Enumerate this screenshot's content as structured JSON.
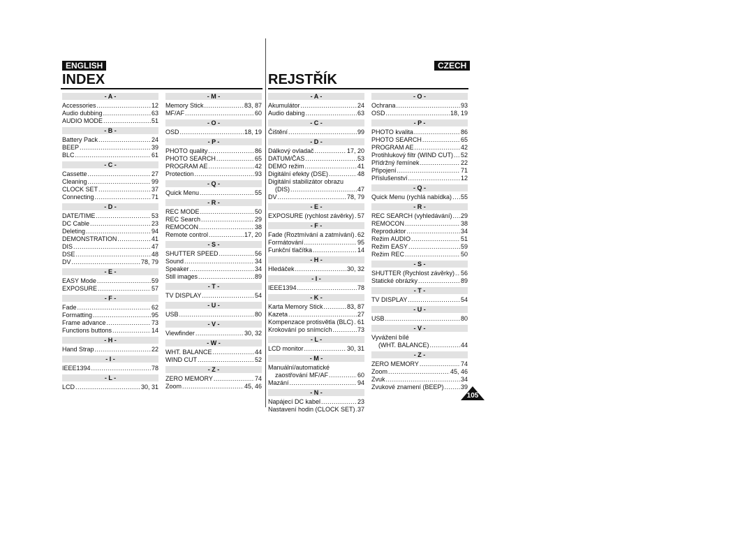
{
  "english": {
    "lang_label": "ENGLISH",
    "title": "INDEX"
  },
  "czech": {
    "lang_label": "CZECH",
    "title": "REJSTŘÍK"
  },
  "page_number": "105",
  "columns": [
    [
      {
        "h": "- A -",
        "items": [
          [
            "Accessories",
            "12"
          ],
          [
            "Audio dubbing",
            "63"
          ],
          [
            "AUDIO MODE",
            "51"
          ]
        ]
      },
      {
        "h": "- B -",
        "items": [
          [
            "Battery Pack",
            "24"
          ],
          [
            "BEEP",
            "39"
          ],
          [
            "BLC",
            "61"
          ]
        ]
      },
      {
        "h": "- C -",
        "items": [
          [
            "Cassette",
            "27"
          ],
          [
            "Cleaning",
            "99"
          ],
          [
            "CLOCK SET",
            "37"
          ],
          [
            "Connecting",
            "71"
          ]
        ]
      },
      {
        "h": "- D -",
        "items": [
          [
            "DATE/TIME",
            "53"
          ],
          [
            "DC Cable",
            "23"
          ],
          [
            "Deleting",
            "94"
          ],
          [
            "DEMONSTRATION",
            "41"
          ],
          [
            "DIS",
            "47"
          ],
          [
            "DSE",
            "48"
          ],
          [
            "DV",
            "78, 79"
          ]
        ]
      },
      {
        "h": "- E -",
        "items": [
          [
            "EASY Mode",
            "59"
          ],
          [
            "EXPOSURE",
            "57"
          ]
        ]
      },
      {
        "h": "- F -",
        "items": [
          [
            "Fade",
            "62"
          ],
          [
            "Formatting",
            "95"
          ],
          [
            "Frame advance",
            "73"
          ],
          [
            "Functions buttons",
            "14"
          ]
        ]
      },
      {
        "h": "- H -",
        "items": [
          [
            "Hand Strap",
            "22"
          ]
        ]
      },
      {
        "h": "- I -",
        "items": [
          [
            "IEEE1394",
            "78"
          ]
        ]
      },
      {
        "h": "- L -",
        "items": [
          [
            "LCD",
            "30, 31"
          ]
        ]
      }
    ],
    [
      {
        "h": "- M -",
        "items": [
          [
            "Memory Stick",
            "83, 87"
          ],
          [
            "MF/AF",
            "60"
          ]
        ]
      },
      {
        "h": "- O -",
        "items": [
          [
            "OSD",
            "18, 19"
          ]
        ]
      },
      {
        "h": "- P -",
        "items": [
          [
            "PHOTO quality",
            "86"
          ],
          [
            "PHOTO SEARCH",
            "65"
          ],
          [
            "PROGRAM AE",
            "42"
          ],
          [
            "Protection",
            "93"
          ]
        ]
      },
      {
        "h": "- Q -",
        "items": [
          [
            "Quick Menu",
            "55"
          ]
        ]
      },
      {
        "h": "- R -",
        "items": [
          [
            "REC MODE",
            "50"
          ],
          [
            "REC Search",
            "29"
          ],
          [
            "REMOCON",
            "38"
          ],
          [
            "Remote control",
            "17, 20"
          ]
        ]
      },
      {
        "h": "- S -",
        "items": [
          [
            "SHUTTER SPEED",
            "56"
          ],
          [
            "Sound",
            "34"
          ],
          [
            "Speaker",
            "34"
          ],
          [
            "Still images",
            "89"
          ]
        ]
      },
      {
        "h": "- T -",
        "items": [
          [
            "TV DISPLAY",
            "54"
          ]
        ]
      },
      {
        "h": "- U -",
        "items": [
          [
            "USB",
            "80"
          ]
        ]
      },
      {
        "h": "- V -",
        "items": [
          [
            "Viewfinder",
            "30, 32"
          ]
        ]
      },
      {
        "h": "- W -",
        "items": [
          [
            "WHT. BALANCE",
            "44"
          ],
          [
            "WIND CUT",
            "52"
          ]
        ]
      },
      {
        "h": "- Z -",
        "items": [
          [
            "ZERO MEMORY",
            "74"
          ],
          [
            "Zoom",
            "45, 46"
          ]
        ]
      }
    ],
    [
      {
        "h": "- A -",
        "items": [
          [
            "Akumulátor",
            "24"
          ],
          [
            "Audio dabing",
            "63"
          ]
        ]
      },
      {
        "h": "- C -",
        "items": [
          [
            "Čištění",
            "99"
          ]
        ]
      },
      {
        "h": "- D -",
        "items": [
          [
            "Dálkový ovladač",
            "17, 20"
          ],
          [
            "DATUM/ČAS",
            "53"
          ],
          [
            "DEMO režim",
            "41"
          ],
          [
            "Digitální efekty (DSE)",
            "48"
          ],
          [
            "Digitální stabilizátor obrazu",
            ""
          ],
          [
            "(DIS)",
            "47",
            "indent"
          ],
          [
            "DV",
            "78, 79"
          ]
        ]
      },
      {
        "h": "- E -",
        "items": [
          [
            "EXPOSURE (rychlost závěrky)",
            "57"
          ]
        ]
      },
      {
        "h": "- F -",
        "items": [
          [
            "Fade (Roztmívání a zatmívání)",
            "62"
          ],
          [
            "Formátování",
            "95"
          ],
          [
            "Funkční tlačítka",
            "14"
          ]
        ]
      },
      {
        "h": "- H -",
        "items": [
          [
            "Hledáček",
            "30, 32"
          ]
        ]
      },
      {
        "h": "- I -",
        "items": [
          [
            "IEEE1394",
            "78"
          ]
        ]
      },
      {
        "h": "- K -",
        "items": [
          [
            "Karta Memory Stick",
            "83, 87"
          ],
          [
            "Kazeta",
            "27"
          ],
          [
            "Kompenzace protisvětla (BLC)",
            "61"
          ],
          [
            "Krokování po snímcích",
            "73"
          ]
        ]
      },
      {
        "h": "- L -",
        "items": [
          [
            "LCD monitor",
            "30, 31"
          ]
        ]
      },
      {
        "h": "- M -",
        "items": [
          [
            "Manuální/automatické",
            ""
          ],
          [
            "zaostřování MF/AF",
            "60",
            "indent"
          ],
          [
            "Mazání",
            "94"
          ]
        ]
      },
      {
        "h": "- N -",
        "items": [
          [
            "Napájecí DC kabel",
            "23"
          ],
          [
            "Nastavení hodin (CLOCK SET)",
            "37"
          ]
        ]
      }
    ],
    [
      {
        "h": "- O -",
        "items": [
          [
            "Ochrana",
            "93"
          ],
          [
            "OSD",
            "18, 19"
          ]
        ]
      },
      {
        "h": "- P -",
        "items": [
          [
            "PHOTO kvalita",
            "86"
          ],
          [
            "PHOTO SEARCH",
            "65"
          ],
          [
            "PROGRAM AE",
            "42"
          ],
          [
            "Protihlukový filtr (WIND CUT)",
            "52"
          ],
          [
            "Přídržný řemínek",
            "22"
          ],
          [
            "Připojení",
            "71"
          ],
          [
            "Příslušenství",
            "12"
          ]
        ]
      },
      {
        "h": "- Q -",
        "items": [
          [
            "Quick Menu (rychlá nabídka)",
            "55"
          ]
        ]
      },
      {
        "h": "- R -",
        "items": [
          [
            "REC SEARCH (vyhledávání)",
            "29"
          ],
          [
            "REMOCON",
            "38"
          ],
          [
            "Reproduktor",
            "34"
          ],
          [
            "Režim AUDIO",
            "51"
          ],
          [
            "Režim EASY",
            "59"
          ],
          [
            "Režim REC",
            "50"
          ]
        ]
      },
      {
        "h": "- S -",
        "items": [
          [
            "SHUTTER (Rychlost závěrky)",
            "56"
          ],
          [
            "Statické obrázky",
            "89"
          ]
        ]
      },
      {
        "h": "- T -",
        "items": [
          [
            "TV DISPLAY",
            "54"
          ]
        ]
      },
      {
        "h": "- U -",
        "items": [
          [
            "USB",
            "80"
          ]
        ]
      },
      {
        "h": "- V -",
        "items": [
          [
            "Vyvážení bílé",
            ""
          ],
          [
            "(WHT. BALANCE)",
            "44",
            "indent"
          ]
        ]
      },
      {
        "h": "- Z -",
        "items": [
          [
            "ZERO MEMORY",
            "74"
          ],
          [
            "Zoom",
            "45, 46"
          ],
          [
            "Zvuk",
            "34"
          ],
          [
            "Zvukové znamení (BEEP)",
            "39"
          ]
        ]
      }
    ]
  ]
}
